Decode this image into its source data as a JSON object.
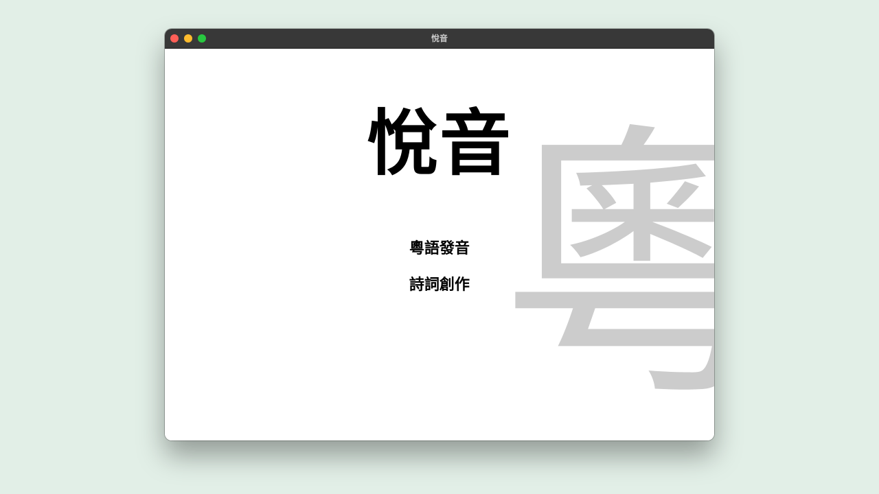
{
  "window": {
    "title": "悅音"
  },
  "main": {
    "title": "悅音",
    "watermark_char": "粵",
    "menu": [
      {
        "label": "粵語發音"
      },
      {
        "label": "詩詞創作"
      }
    ]
  },
  "colors": {
    "background": "#e2efe7",
    "titlebar": "#383838",
    "content": "#ffffff",
    "watermark": "#cccccc",
    "text": "#000000",
    "close": "#ff5f57",
    "minimize": "#febc2e",
    "zoom": "#28c840"
  }
}
